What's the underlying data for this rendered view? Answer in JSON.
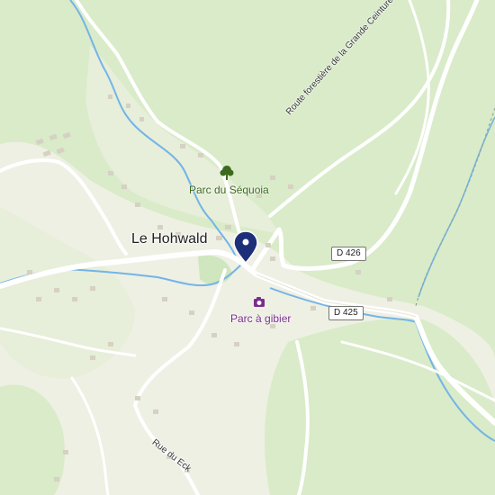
{
  "map": {
    "place_label": "Le Hohwald",
    "poi_park": "Parc du Séquoia",
    "poi_game_park": "Parc à gibier",
    "road_forest": "Route forestière de la Grande Ceinture",
    "road_eck": "Rue du Eck",
    "shield_d426": "D 426",
    "shield_d425": "D 425"
  },
  "colors": {
    "forest": "#d9ebc8",
    "clearing": "#eef0e3",
    "road": "#ffffff",
    "water": "#73b4e8",
    "pin": "#1e2f7a",
    "park_icon": "#3e6a1f",
    "camera_icon": "#7b2d8e"
  }
}
